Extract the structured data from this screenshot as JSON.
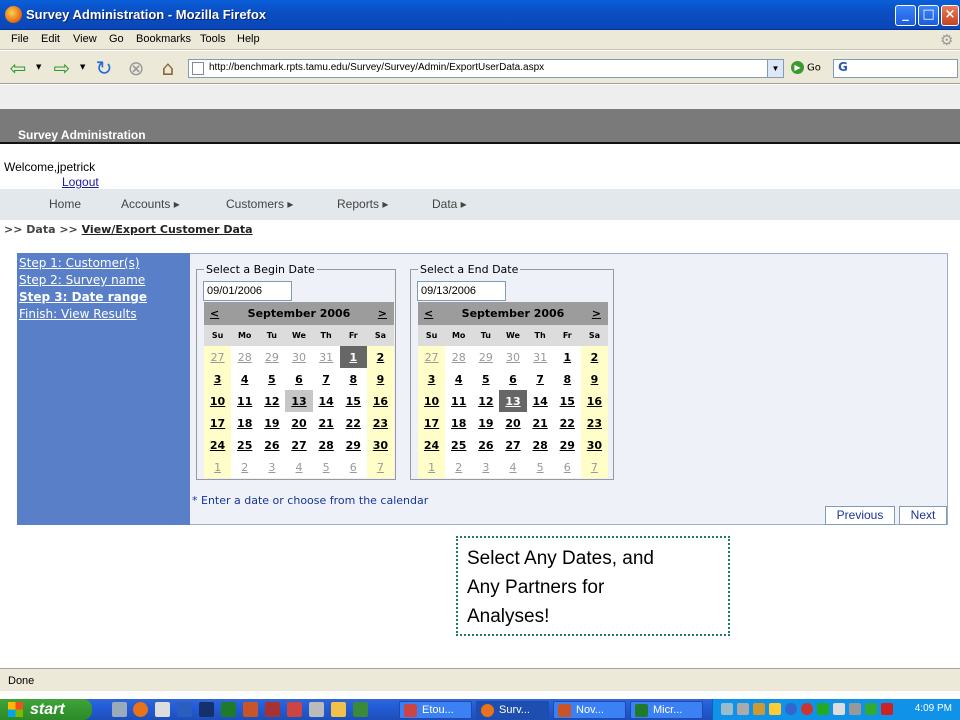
{
  "window": {
    "title": "Survey Administration - Mozilla Firefox"
  },
  "menubar": [
    "File",
    "Edit",
    "View",
    "Go",
    "Bookmarks",
    "Tools",
    "Help"
  ],
  "toolbar": {
    "url": "http://benchmark.rpts.tamu.edu/Survey/Survey/Admin/ExportUserData.aspx",
    "go_label": "Go",
    "search_text": "G"
  },
  "app": {
    "title": "Survey Administration",
    "welcome": "Welcome,jpetrick",
    "logout": "Logout",
    "nav": [
      "Home",
      "Accounts ▸",
      "Customers ▸",
      "Reports ▸",
      "Data ▸"
    ],
    "breadcrumb": {
      "prefix": ">> Data >>",
      "current": "View/Export Customer Data"
    },
    "steps": [
      "Step 1: Customer(s)",
      "Step 2: Survey name",
      "Step 3: Date range",
      "Finish: View Results"
    ],
    "hint": "* Enter a date or choose from the calendar",
    "buttons": {
      "previous": "Previous",
      "next": "Next"
    }
  },
  "begin": {
    "legend": "Select a Begin Date",
    "value": "09/01/2006",
    "month": "September 2006",
    "prev": "<",
    "next": ">"
  },
  "end": {
    "legend": "Select a End Date",
    "value": "09/13/2006",
    "month": "September 2006",
    "prev": "<",
    "next": ">"
  },
  "weekdays": [
    "Su",
    "Mo",
    "Tu",
    "We",
    "Th",
    "Fr",
    "Sa"
  ],
  "calendar_days": [
    [
      "27",
      "28",
      "29",
      "30",
      "31",
      "1",
      "2"
    ],
    [
      "3",
      "4",
      "5",
      "6",
      "7",
      "8",
      "9"
    ],
    [
      "10",
      "11",
      "12",
      "13",
      "14",
      "15",
      "16"
    ],
    [
      "17",
      "18",
      "19",
      "20",
      "21",
      "22",
      "23"
    ],
    [
      "24",
      "25",
      "26",
      "27",
      "28",
      "29",
      "30"
    ],
    [
      "1",
      "2",
      "3",
      "4",
      "5",
      "6",
      "7"
    ]
  ],
  "note": {
    "line1": "Select Any Dates, and",
    "line2": "Any Partners for",
    "line3": "Analyses!"
  },
  "status": "Done",
  "taskbar": {
    "start": "start",
    "tasks": [
      "Etou...",
      "Surv...",
      "Nov...",
      "Micr..."
    ],
    "clock": "4:09 PM"
  }
}
